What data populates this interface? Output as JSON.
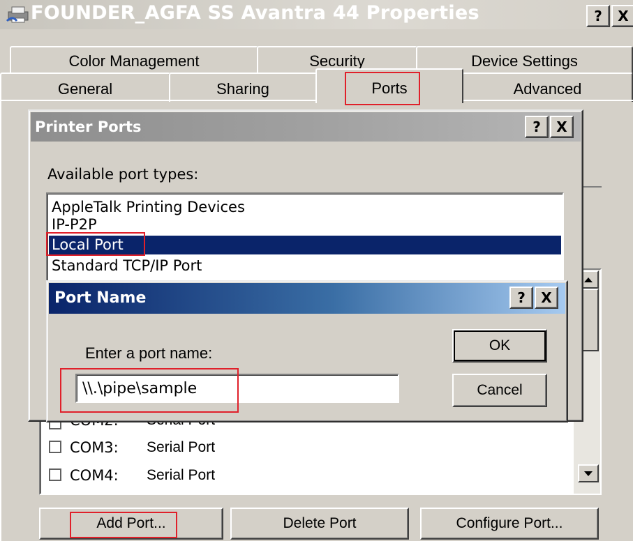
{
  "window": {
    "title": "FOUNDER_AGFA SS Avantra 44 Properties",
    "help_label": "?",
    "close_label": "X"
  },
  "tabs_row1": [
    {
      "label": "Color Management"
    },
    {
      "label": "Security"
    },
    {
      "label": "Device Settings"
    }
  ],
  "tabs_row2": [
    {
      "label": "General"
    },
    {
      "label": "Sharing"
    },
    {
      "label": "Ports"
    },
    {
      "label": "Advanced"
    }
  ],
  "printer_ports": {
    "title": "Printer Ports",
    "help_label": "?",
    "close_label": "X",
    "available_label": "Available port types:",
    "port_types": [
      {
        "label": "AppleTalk Printing Devices"
      },
      {
        "label": "IP-P2P"
      },
      {
        "label": "Local Port"
      },
      {
        "label": "Standard TCP/IP Port"
      }
    ],
    "selected": "Local Port"
  },
  "port_name_dialog": {
    "title": "Port Name",
    "help_label": "?",
    "close_label": "X",
    "prompt": "Enter a port name:",
    "input_value": "\\\\.\\pipe\\sample",
    "ok_label": "OK",
    "cancel_label": "Cancel"
  },
  "ports_list": [
    {
      "port": "COM2:",
      "desc": "Serial Port"
    },
    {
      "port": "COM3:",
      "desc": "Serial Port"
    },
    {
      "port": "COM4:",
      "desc": "Serial Port"
    }
  ],
  "buttons": {
    "add_port": "Add Port...",
    "delete_port": "Delete Port",
    "configure_port": "Configure Port..."
  },
  "colors": {
    "highlight": "#0a246a",
    "annotation": "#e0202a",
    "dialog_title_start": "#0a246a",
    "dialog_title_end": "#a6caf0"
  }
}
